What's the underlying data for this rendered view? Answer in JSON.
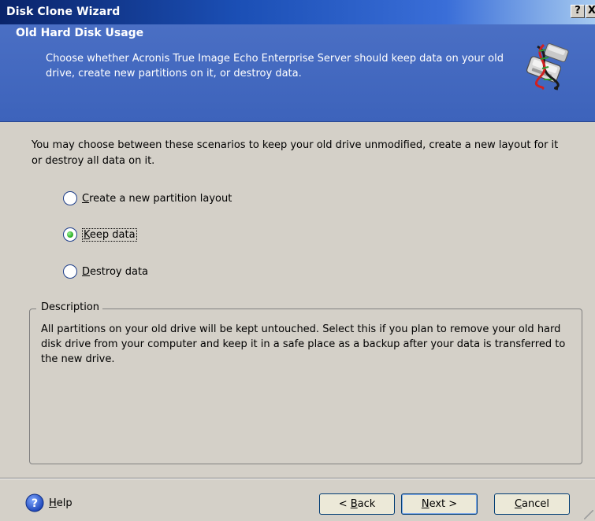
{
  "window": {
    "title": "Disk Clone Wizard",
    "help_button": "?",
    "close_button": "X"
  },
  "header": {
    "title": "Old Hard Disk Usage",
    "description": "Choose whether Acronis True Image Echo Enterprise Server should keep data on your old drive, create new partitions on it, or destroy data."
  },
  "intro": "You may choose between these scenarios to keep your old drive unmodified, create a new layout for it or destroy all data on it.",
  "options": [
    {
      "mnemonic": "C",
      "label_rest": "reate a new partition layout",
      "checked": false
    },
    {
      "mnemonic": "K",
      "label_rest": "eep data",
      "checked": true
    },
    {
      "mnemonic": "D",
      "label_rest": "estroy data",
      "checked": false
    }
  ],
  "description_group": {
    "legend": "Description",
    "text": "All partitions on your old drive will be kept untouched. Select this if you plan to remove your old hard disk drive from your computer and keep it in a safe place as a backup after your data is transferred to the new drive."
  },
  "footer": {
    "help_mnemonic": "H",
    "help_rest": "elp",
    "back_prefix": "< ",
    "back_mnemonic": "B",
    "back_rest": "ack",
    "next_mnemonic": "N",
    "next_rest": "ext >",
    "cancel_mnemonic": "C",
    "cancel_rest": "ancel"
  },
  "colors": {
    "header_blue": "#4a6fc4",
    "radio_checked": "#2fb32a",
    "titlebar": "#0a246a"
  },
  "icons": {
    "header": "disk-clone-icon",
    "help": "help-icon"
  }
}
